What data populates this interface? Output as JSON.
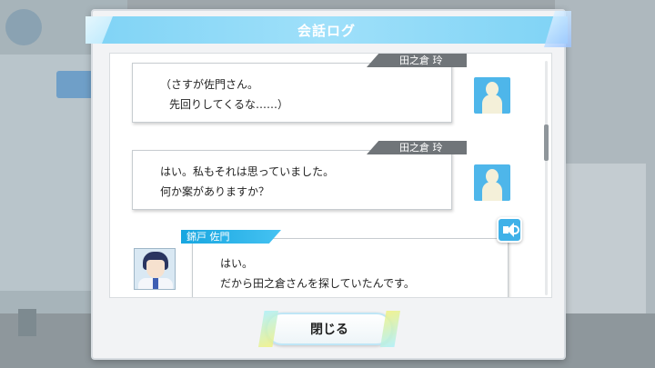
{
  "dialog": {
    "title": "会話ログ",
    "close_label": "閉じる"
  },
  "log": [
    {
      "speaker": "田之倉 玲",
      "lines": [
        "（さすが佐門さん。",
        "先回りしてくるな……）"
      ],
      "avatar": "generic-person-icon"
    },
    {
      "speaker": "田之倉 玲",
      "lines": [
        "はい。私もそれは思っていました。",
        "何か案がありますか？"
      ],
      "avatar": "generic-person-icon"
    },
    {
      "speaker": "錦戸 佐門",
      "lines": [
        "はい。",
        "だから田之倉さんを探していたんです。"
      ],
      "avatar": "character-portrait",
      "voice": "speaker-icon"
    }
  ],
  "colors": {
    "title_bar": "#7fd3f5",
    "name_tag_player": "#707579",
    "name_tag_character": "#17a6e0",
    "avatar_bg": "#4eb6ea"
  }
}
